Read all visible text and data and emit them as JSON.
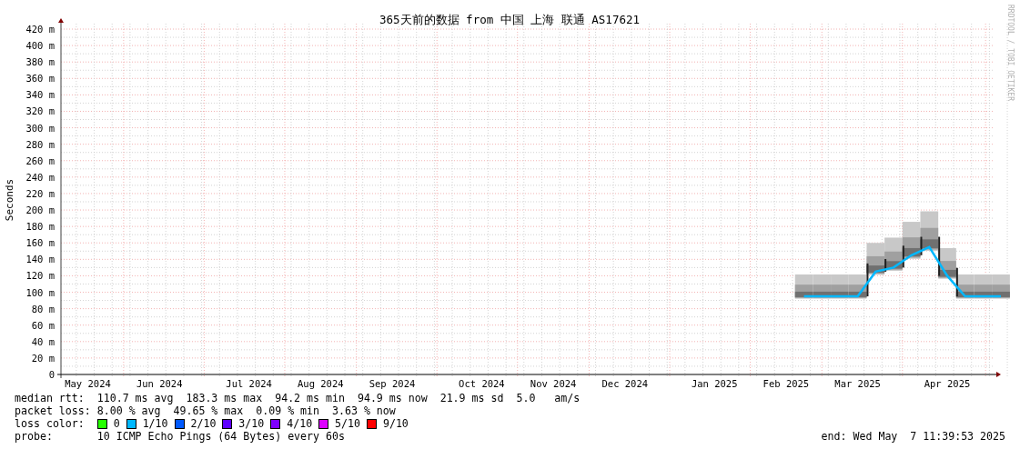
{
  "chart_data": {
    "type": "line",
    "grid": true,
    "title": "365天前的数据 from 中国 上海 联通 AS17621",
    "ylabel": "Seconds",
    "ylim": [
      0,
      420
    ],
    "yticks": [
      {
        "value": 0,
        "label": "0"
      },
      {
        "value": 20,
        "label": "20 m"
      },
      {
        "value": 40,
        "label": "40 m"
      },
      {
        "value": 60,
        "label": "60 m"
      },
      {
        "value": 80,
        "label": "80 m"
      },
      {
        "value": 100,
        "label": "100 m"
      },
      {
        "value": 120,
        "label": "120 m"
      },
      {
        "value": 140,
        "label": "140 m"
      },
      {
        "value": 160,
        "label": "160 m"
      },
      {
        "value": 180,
        "label": "180 m"
      },
      {
        "value": 200,
        "label": "200 m"
      },
      {
        "value": 220,
        "label": "220 m"
      },
      {
        "value": 240,
        "label": "240 m"
      },
      {
        "value": 260,
        "label": "260 m"
      },
      {
        "value": 280,
        "label": "280 m"
      },
      {
        "value": 300,
        "label": "300 m"
      },
      {
        "value": 320,
        "label": "320 m"
      },
      {
        "value": 340,
        "label": "340 m"
      },
      {
        "value": 360,
        "label": "360 m"
      },
      {
        "value": 380,
        "label": "380 m"
      },
      {
        "value": 400,
        "label": "400 m"
      },
      {
        "value": 420,
        "label": "420 m"
      }
    ],
    "categories": [
      null,
      "May 2024",
      null,
      null,
      null,
      "Jun 2024",
      null,
      null,
      null,
      null,
      "Jul 2024",
      null,
      null,
      null,
      "Aug 2024",
      null,
      null,
      null,
      "Sep 2024",
      null,
      null,
      null,
      null,
      "Oct 2024",
      null,
      null,
      null,
      "Nov 2024",
      null,
      null,
      null,
      "Dec 2024",
      null,
      null,
      null,
      null,
      "Jan 2025",
      null,
      null,
      null,
      "Feb 2025",
      null,
      null,
      null,
      "Mar 2025",
      null,
      null,
      null,
      null,
      "Apr 2025",
      null,
      null,
      null
    ],
    "series": [
      {
        "name": "median rtt:",
        "color": "#00b8ff",
        "values": [
          null,
          null,
          null,
          null,
          null,
          null,
          null,
          null,
          null,
          null,
          null,
          null,
          null,
          null,
          null,
          null,
          null,
          null,
          null,
          null,
          null,
          null,
          null,
          null,
          null,
          null,
          null,
          null,
          null,
          null,
          null,
          null,
          null,
          null,
          null,
          null,
          null,
          null,
          null,
          null,
          null,
          95,
          95,
          95,
          95,
          125,
          130,
          145,
          155,
          120,
          95,
          95,
          95
        ]
      }
    ]
  },
  "credit": "RRDTOOL / TOBI OETIKER",
  "stats": [
    {
      "value": "110.7 ms avg  183.3 ms max  94.2 ms min  94.9 ms now  21.9 ms sd  5.0   am/s"
    },
    {
      "label": "packet loss:",
      "value": "8.00 % avg  49.65 % max  0.09 % min  3.63 % now"
    }
  ],
  "loss_colors": {
    "label": "loss color:",
    "items": [
      {
        "label": "0",
        "color": "#26ff00"
      },
      {
        "label": "1/10",
        "color": "#00b8ff"
      },
      {
        "label": "2/10",
        "color": "#0059ff"
      },
      {
        "label": "3/10",
        "color": "#5e00ff"
      },
      {
        "label": "4/10",
        "color": "#7e00ff"
      },
      {
        "label": "5/10",
        "color": "#dd00ff"
      },
      {
        "label": "9/10",
        "color": "#ff0000"
      }
    ]
  },
  "probe": {
    "label": "probe:",
    "value": "10 ICMP Echo Pings (64 Bytes) every 60s"
  },
  "end": "end: Wed May  7 11:39:53 2025"
}
